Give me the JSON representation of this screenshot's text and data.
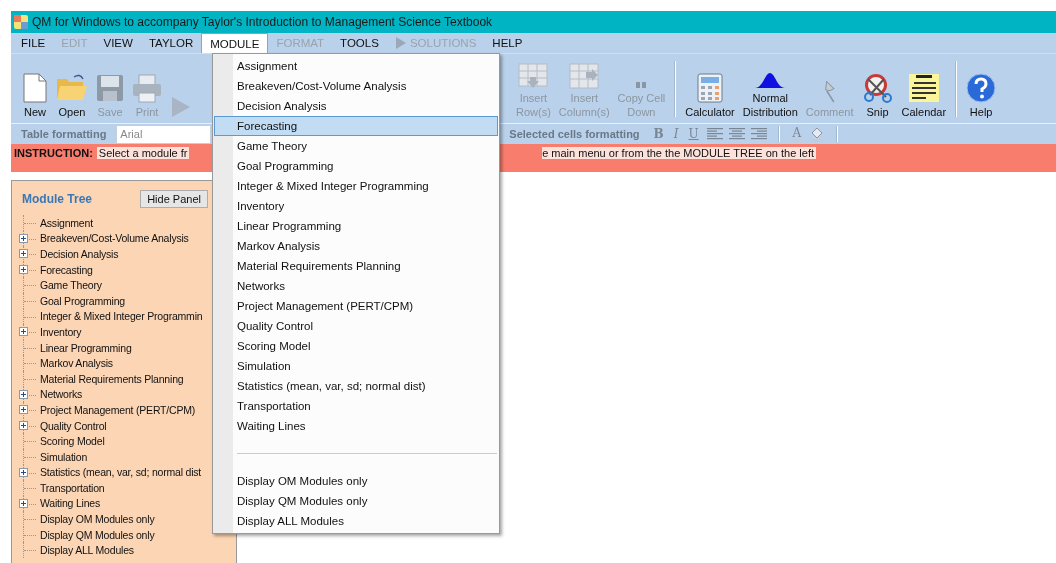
{
  "window": {
    "title": "QM for Windows to accompany Taylor's Introduction to Management Science Textbook"
  },
  "menu_bar": [
    {
      "label": "FILE",
      "disabled": false,
      "selected": false
    },
    {
      "label": "EDIT",
      "disabled": true,
      "selected": false
    },
    {
      "label": "VIEW",
      "disabled": false,
      "selected": false
    },
    {
      "label": "TAYLOR",
      "disabled": false,
      "selected": false
    },
    {
      "label": "MODULE",
      "disabled": false,
      "selected": true
    },
    {
      "label": "FORMAT",
      "disabled": true,
      "selected": false
    },
    {
      "label": "TOOLS",
      "disabled": false,
      "selected": false
    },
    {
      "label": "SOLUTIONS",
      "disabled": true,
      "selected": false,
      "kind": "play"
    },
    {
      "label": "HELP",
      "disabled": false,
      "selected": false
    }
  ],
  "toolbar_left": [
    {
      "kind": "new",
      "label": "New",
      "disabled": false
    },
    {
      "kind": "open",
      "label": "Open",
      "disabled": false
    },
    {
      "kind": "save",
      "label": "Save",
      "disabled": true
    },
    {
      "kind": "print",
      "label": "Print",
      "disabled": true
    },
    {
      "kind": "play",
      "disabled": true
    }
  ],
  "toolbar_right": [
    {
      "kind": "insert-row",
      "label": "Insert\nRow(s)",
      "disabled": true
    },
    {
      "kind": "insert-column",
      "label": "Insert\nColumn(s)",
      "disabled": true
    },
    {
      "kind": "copy-down",
      "label": "Copy Cell\nDown",
      "disabled": true
    },
    {
      "kind": "separator"
    },
    {
      "kind": "calculator",
      "label": "Calculator",
      "disabled": false
    },
    {
      "kind": "normal",
      "label": "Normal\nDistribution",
      "disabled": false
    },
    {
      "kind": "comment",
      "label": "Comment",
      "disabled": true
    },
    {
      "kind": "snip",
      "label": "Snip",
      "disabled": false
    },
    {
      "kind": "calendar",
      "label": "Calendar",
      "disabled": false
    },
    {
      "kind": "separator"
    },
    {
      "kind": "help",
      "label": "Help",
      "disabled": false
    }
  ],
  "format_bar": {
    "table_label": "Table formatting",
    "font_value": "Arial",
    "cells_label": "Selected cells formatting",
    "tools": [
      {
        "kind": "bold",
        "label": "B"
      },
      {
        "kind": "italic",
        "label": "I"
      },
      {
        "kind": "underline",
        "label": "U"
      },
      {
        "kind": "align-left"
      },
      {
        "kind": "align-center"
      },
      {
        "kind": "align-right"
      },
      {
        "kind": "separator"
      },
      {
        "kind": "font-color",
        "label": "A"
      },
      {
        "kind": "fill"
      }
    ]
  },
  "instruction": {
    "label": "INSTRUCTION:",
    "text_before_menu": "Select a module fr",
    "text_after_menu": "e main menu or from the the MODULE TREE on the left"
  },
  "module_tree": {
    "title": "Module Tree",
    "hide_button": "Hide Panel",
    "items": [
      {
        "label": "Assignment",
        "expandable": false
      },
      {
        "label": "Breakeven/Cost-Volume Analysis",
        "expandable": true
      },
      {
        "label": "Decision Analysis",
        "expandable": true
      },
      {
        "label": "Forecasting",
        "expandable": true
      },
      {
        "label": "Game Theory",
        "expandable": false
      },
      {
        "label": "Goal Programming",
        "expandable": false
      },
      {
        "label": "Integer & Mixed Integer Programmin",
        "expandable": false
      },
      {
        "label": "Inventory",
        "expandable": true
      },
      {
        "label": "Linear Programming",
        "expandable": false
      },
      {
        "label": "Markov Analysis",
        "expandable": false
      },
      {
        "label": "Material Requirements Planning",
        "expandable": false
      },
      {
        "label": "Networks",
        "expandable": true
      },
      {
        "label": "Project Management (PERT/CPM)",
        "expandable": true
      },
      {
        "label": "Quality Control",
        "expandable": true
      },
      {
        "label": "Scoring Model",
        "expandable": false
      },
      {
        "label": "Simulation",
        "expandable": false
      },
      {
        "label": "Statistics (mean, var, sd; normal dist",
        "expandable": true
      },
      {
        "label": "Transportation",
        "expandable": false
      },
      {
        "label": "Waiting Lines",
        "expandable": true
      },
      {
        "label": "Display OM Modules only",
        "expandable": false
      },
      {
        "label": "Display QM Modules only",
        "expandable": false
      },
      {
        "label": "Display ALL Modules",
        "expandable": false
      }
    ]
  },
  "module_menu": {
    "modules": [
      {
        "kind": "module",
        "label": "Assignment",
        "selected": false
      },
      {
        "kind": "module",
        "label": "Breakeven/Cost-Volume Analysis",
        "selected": false
      },
      {
        "kind": "module",
        "label": "Decision Analysis",
        "selected": false
      },
      {
        "kind": "module",
        "label": "Forecasting",
        "selected": true
      },
      {
        "kind": "module",
        "label": "Game Theory",
        "selected": false
      },
      {
        "kind": "module",
        "label": "Goal Programming",
        "selected": false
      },
      {
        "kind": "module",
        "label": "Integer & Mixed Integer Programming",
        "selected": false
      },
      {
        "kind": "module",
        "label": "Inventory",
        "selected": false
      },
      {
        "kind": "module",
        "label": "Linear Programming",
        "selected": false
      },
      {
        "kind": "module",
        "label": "Markov Analysis",
        "selected": false
      },
      {
        "kind": "module",
        "label": "Material Requirements Planning",
        "selected": false
      },
      {
        "kind": "module",
        "label": "Networks",
        "selected": false
      },
      {
        "kind": "module",
        "label": "Project Management (PERT/CPM)",
        "selected": false
      },
      {
        "kind": "module",
        "label": "Quality Control",
        "selected": false
      },
      {
        "kind": "module",
        "label": "Scoring Model",
        "selected": false
      },
      {
        "kind": "module",
        "label": "Simulation",
        "selected": false
      },
      {
        "kind": "module",
        "label": "Statistics (mean, var, sd; normal dist)",
        "selected": false
      },
      {
        "kind": "module",
        "label": "Transportation",
        "selected": false
      },
      {
        "kind": "module",
        "label": "Waiting Lines",
        "selected": false
      }
    ],
    "display_options": [
      {
        "label": "Display OM Modules only",
        "selected": false
      },
      {
        "label": "Display QM Modules only",
        "selected": false
      },
      {
        "label": "Display ALL Modules",
        "selected": false
      }
    ]
  }
}
